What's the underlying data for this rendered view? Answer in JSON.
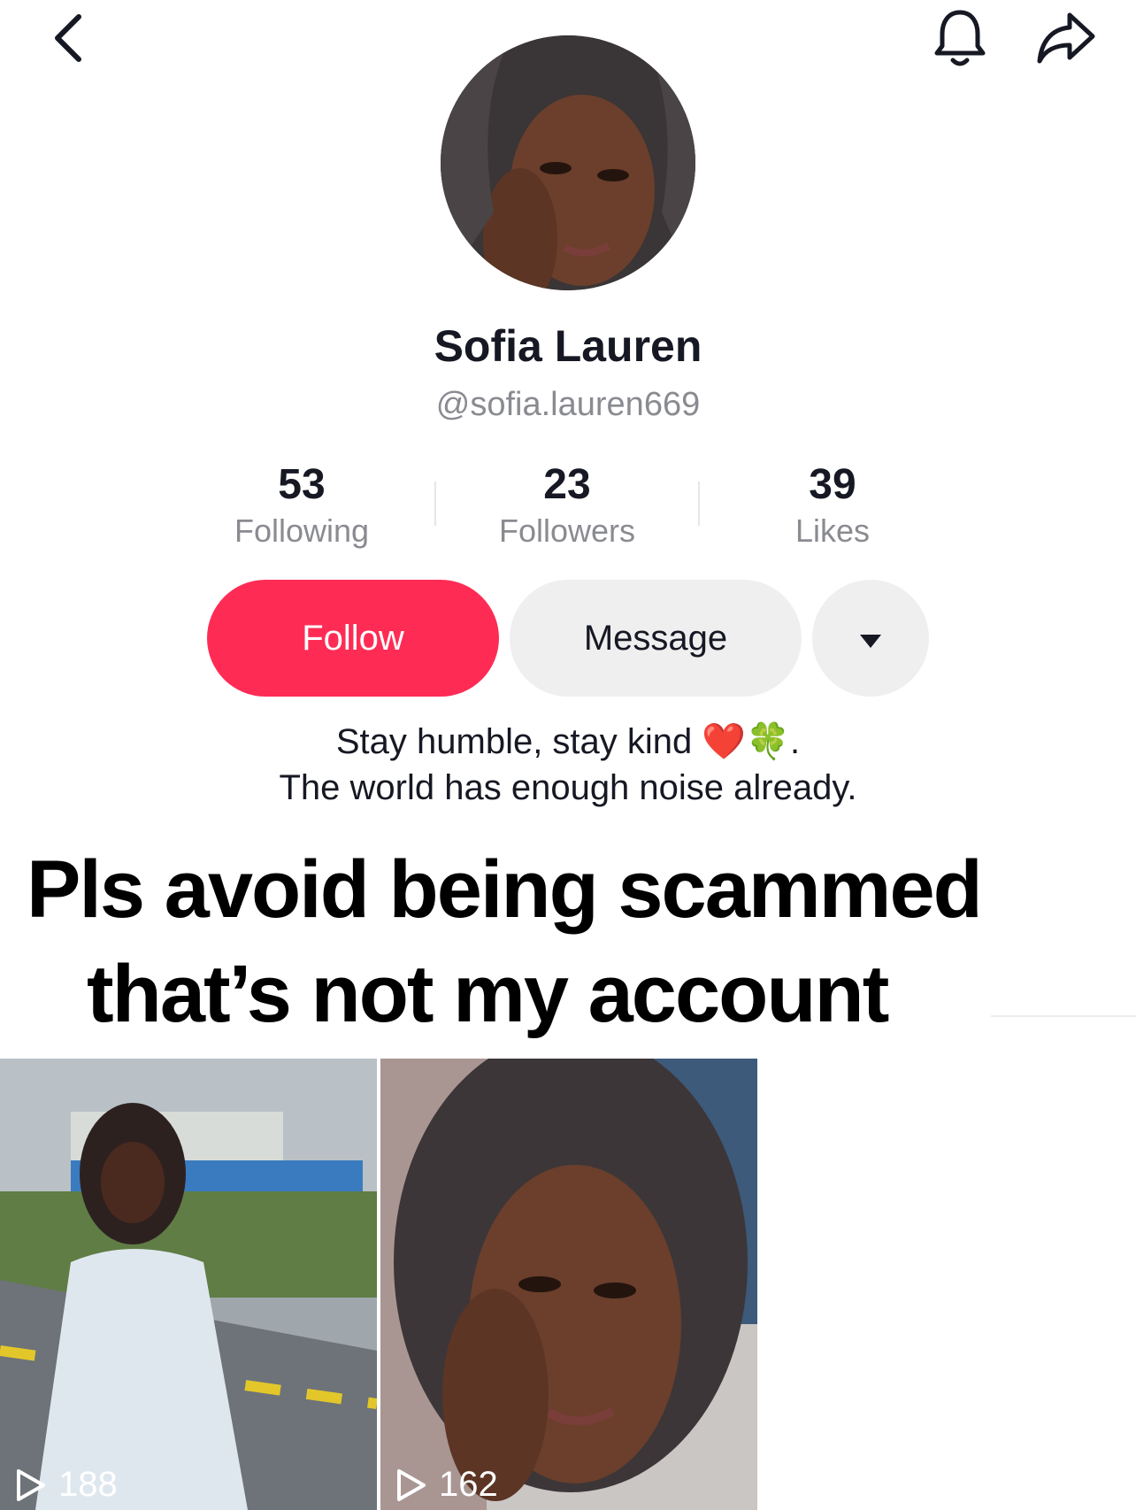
{
  "header": {
    "back_icon": "chevron-left-icon",
    "bell_icon": "bell-icon",
    "share_icon": "share-arrow-icon"
  },
  "profile": {
    "display_name": "Sofia Lauren",
    "username": "@sofia.lauren669",
    "avatar": "profile-photo"
  },
  "stats": [
    {
      "count": "53",
      "label": "Following"
    },
    {
      "count": "23",
      "label": "Followers"
    },
    {
      "count": "39",
      "label": "Likes"
    }
  ],
  "actions": {
    "follow_label": "Follow",
    "message_label": "Message",
    "more_icon": "caret-down-icon"
  },
  "bio": {
    "line1": "Stay humble, stay kind",
    "line1_emoji": "❤️🍀",
    "line1_end": ".",
    "line2": "The world has enough noise already."
  },
  "overlay_caption": {
    "line1": "Pls avoid being scammed",
    "line2": "that’s not my account"
  },
  "videos": [
    {
      "views": "188"
    },
    {
      "views": "162"
    }
  ],
  "colors": {
    "accent": "#fe2c55",
    "text_primary": "#161823",
    "text_secondary": "#8a8b91",
    "button_secondary_bg": "#efefef"
  }
}
